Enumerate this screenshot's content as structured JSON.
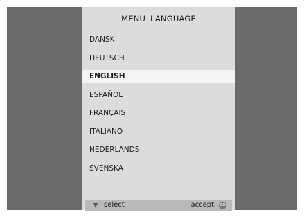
{
  "menu": {
    "title": "MENU LANGUAGE",
    "languages": [
      {
        "label": "DANSK"
      },
      {
        "label": "DEUTSCH"
      },
      {
        "label": "ENGLISH",
        "selected": true
      },
      {
        "label": "ESPAÑOL"
      },
      {
        "label": "FRANÇAIS"
      },
      {
        "label": "ITALIANO"
      },
      {
        "label": "NEDERLANDS"
      },
      {
        "label": "SVENSKA"
      }
    ]
  },
  "status_bar": {
    "select_label": "select",
    "accept_label": "accept",
    "go_icon": "GO"
  },
  "colors": {
    "background": "#6b6b6b",
    "panel": "#dcdcdc",
    "highlight": "#f4f4f4",
    "status_bar": "#b9b9b9"
  }
}
